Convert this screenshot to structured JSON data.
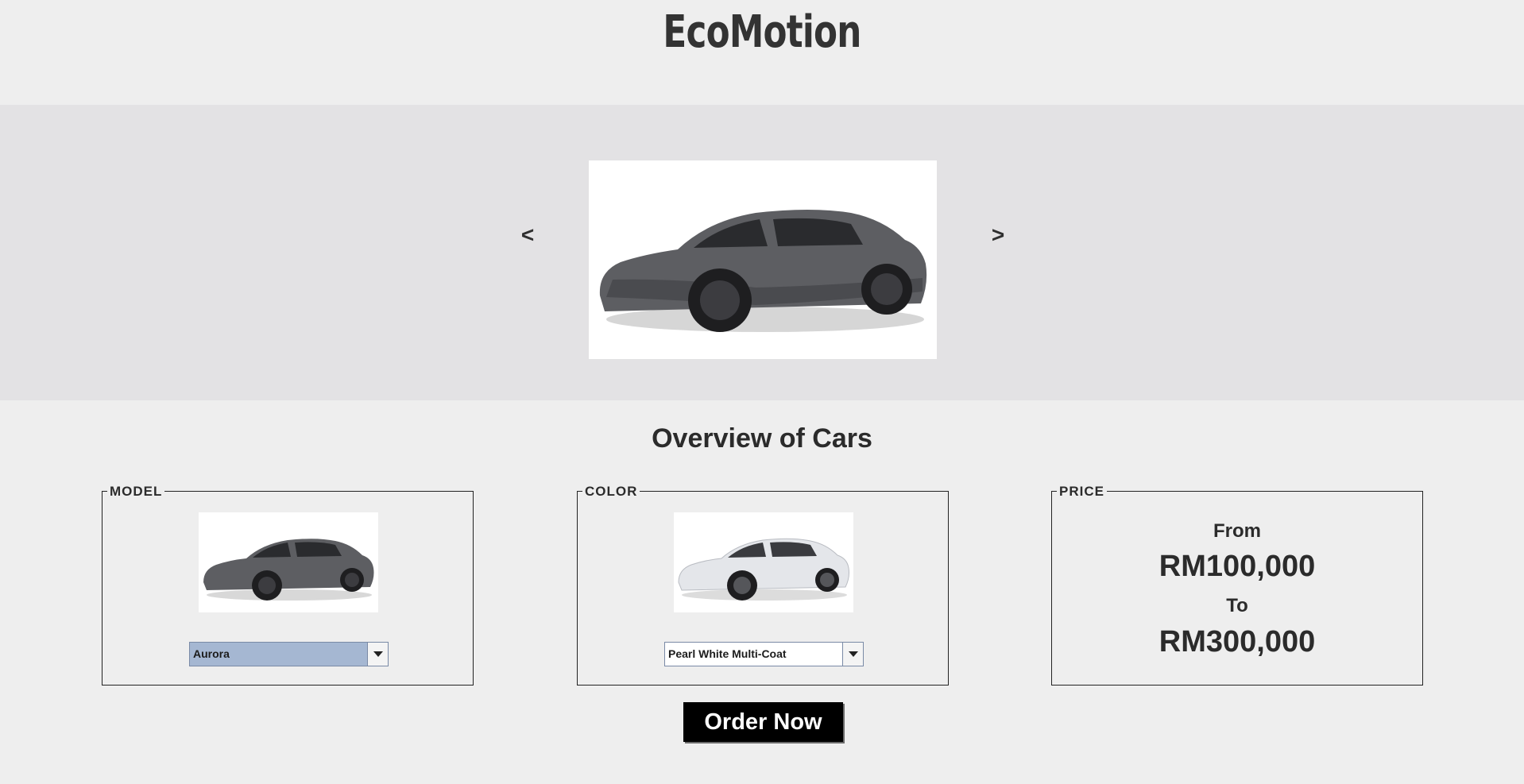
{
  "header": {
    "brand": "EcoMotion"
  },
  "carousel": {
    "prev_label": "<",
    "next_label": ">",
    "image_icon": "car-image-dark-grey",
    "car_color": "#5d5e62"
  },
  "overview": {
    "title": "Overview of Cars",
    "model": {
      "legend": "MODEL",
      "thumb_icon": "car-thumbnail-dark-grey",
      "car_color": "#5d5e62",
      "selected": "Aurora"
    },
    "color": {
      "legend": "COLOR",
      "thumb_icon": "car-thumbnail-white",
      "car_color": "#e4e6ea",
      "selected": "Pearl White Multi-Coat"
    },
    "price": {
      "legend": "PRICE",
      "from_label": "From",
      "min": "RM100,000",
      "to_label": "To",
      "max": "RM300,000"
    }
  },
  "actions": {
    "order_label": "Order Now"
  },
  "colors": {
    "background": "#eeeeee",
    "carousel_band": "#e3e2e4",
    "selected_combo": "#a5b7d2",
    "order_button": "#000000"
  }
}
